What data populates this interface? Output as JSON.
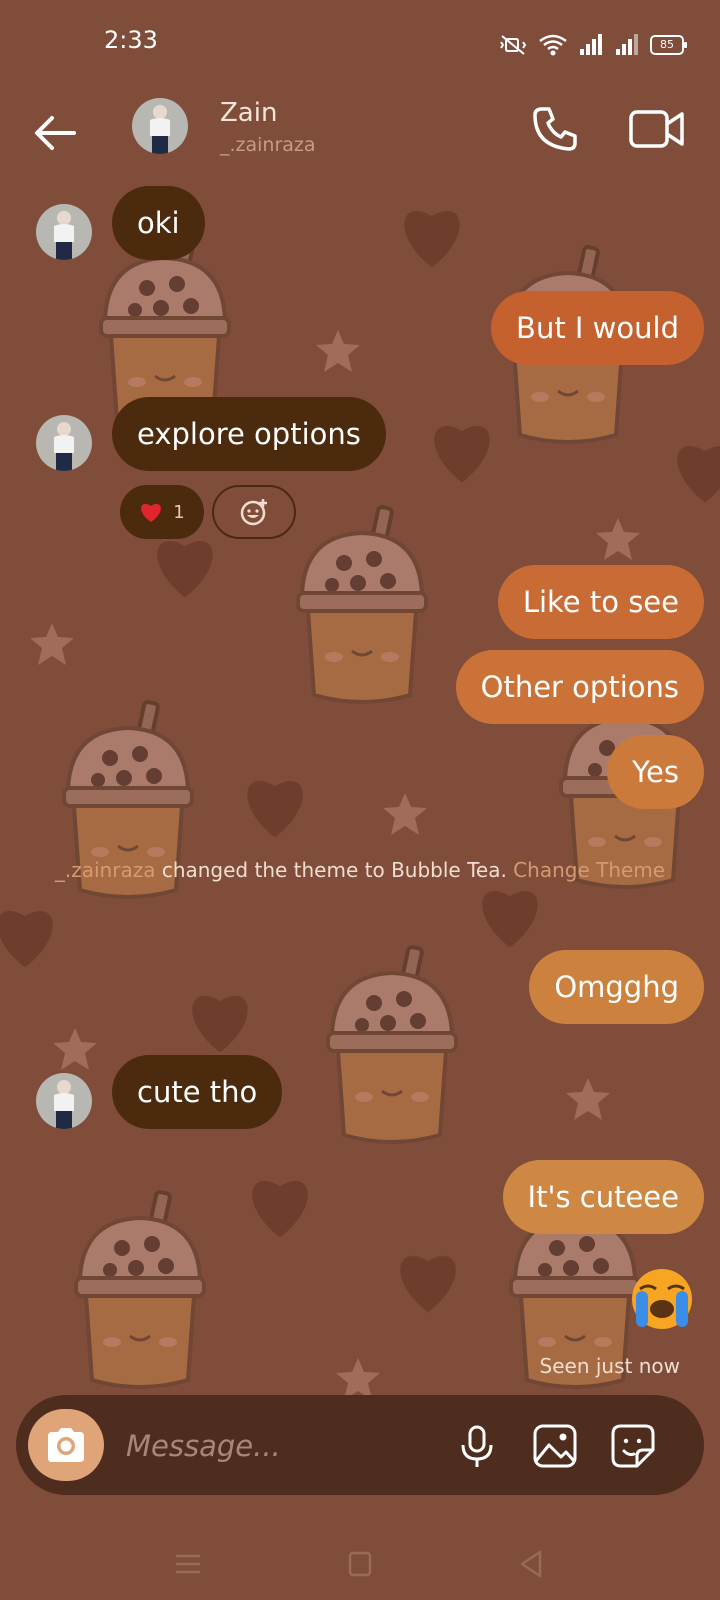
{
  "status_bar": {
    "time": "2:33",
    "battery": "85"
  },
  "header": {
    "name": "Zain",
    "handle": "_.zainraza"
  },
  "messages": [
    {
      "side": "in",
      "text": "oki"
    },
    {
      "side": "out",
      "text": "But I would"
    },
    {
      "side": "in",
      "text": "explore options",
      "reaction": {
        "emoji": "heart",
        "count": "1"
      }
    },
    {
      "side": "out",
      "text": "Like to see"
    },
    {
      "side": "out",
      "text": "Other options"
    },
    {
      "side": "out",
      "text": "Yes"
    },
    {
      "side": "out",
      "text": "Omgghg"
    },
    {
      "side": "in",
      "text": "cute tho"
    },
    {
      "side": "out",
      "text": "It's cuteee",
      "reaction": {
        "emoji": "loudly-crying-face"
      }
    }
  ],
  "system_message": {
    "actor": "_.zainraza",
    "text": " changed the theme to Bubble Tea. ",
    "link": "Change Theme"
  },
  "seen": "Seen just now",
  "composer": {
    "placeholder": "Message..."
  },
  "theme": {
    "background": "#804d3a",
    "incoming_bubble": "#4b2a0e",
    "outgoing_bubble_start": "#c4612f",
    "outgoing_bubble_end": "#cf8843",
    "camera_button": "#e0a479"
  },
  "icons": [
    "back-arrow-icon",
    "phone-icon",
    "video-camera-icon",
    "camera-icon",
    "microphone-icon",
    "gallery-icon",
    "sticker-icon",
    "heart-icon",
    "add-reaction-icon"
  ]
}
